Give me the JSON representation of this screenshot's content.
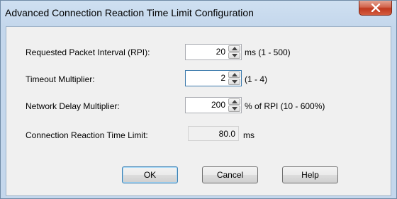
{
  "window": {
    "title": "Advanced Connection Reaction Time Limit Configuration"
  },
  "fields": {
    "rpi": {
      "label": "Requested Packet Interval (RPI):",
      "value": "20",
      "suffix": "ms    (1 - 500)"
    },
    "timeout": {
      "label": "Timeout Multiplier:",
      "value": "2",
      "suffix": "(1 - 4)"
    },
    "network_delay": {
      "label": "Network Delay Multiplier:",
      "value": "200",
      "suffix": "% of RPI (10 - 600%)"
    },
    "reaction_limit": {
      "label": "Connection Reaction Time Limit:",
      "value": "80.0",
      "suffix": "ms"
    }
  },
  "buttons": {
    "ok": "OK",
    "cancel": "Cancel",
    "help": "Help"
  },
  "icons": {
    "close": "close-icon",
    "spin_up": "chevron-up-icon",
    "spin_down": "chevron-down-icon"
  }
}
